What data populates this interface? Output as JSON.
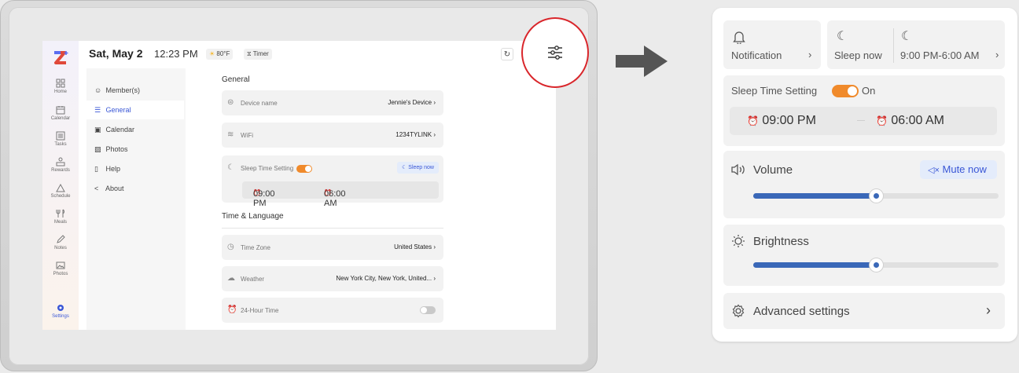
{
  "device_screen": {
    "topbar": {
      "date": "Sat, May 2",
      "time": "12:23 PM",
      "weather": "80°F",
      "timer": "Timer"
    },
    "nav": {
      "items": [
        {
          "label": "Home",
          "icon": "home-icon"
        },
        {
          "label": "Calendar",
          "icon": "calendar-icon"
        },
        {
          "label": "Tasks",
          "icon": "tasks-icon"
        },
        {
          "label": "Rewards",
          "icon": "rewards-icon"
        },
        {
          "label": "Schedule",
          "icon": "schedule-icon"
        },
        {
          "label": "Meals",
          "icon": "meals-icon"
        },
        {
          "label": "Notes",
          "icon": "notes-icon"
        },
        {
          "label": "Photos",
          "icon": "photos-icon"
        },
        {
          "label": "Settings",
          "icon": "settings-icon"
        }
      ]
    },
    "settings_menu": {
      "items": [
        {
          "label": "Member(s)"
        },
        {
          "label": "General"
        },
        {
          "label": "Calendar"
        },
        {
          "label": "Photos"
        },
        {
          "label": "Help"
        },
        {
          "label": "About"
        }
      ],
      "active": "General"
    },
    "general": {
      "heading": "General",
      "device_name_label": "Device name",
      "device_name_value": "Jennie's Device",
      "wifi_label": "WiFi",
      "wifi_value": "1234TYLINK",
      "sleep_label": "Sleep Time Setting",
      "sleep_now": "Sleep now",
      "sleep_start": "09:00 PM",
      "sleep_end": "06:00 AM"
    },
    "time_language": {
      "heading": "Time & Language",
      "timezone_label": "Time Zone",
      "timezone_value": "United States",
      "weather_label": "Weather",
      "weather_value": "New York City, New York, United...",
      "hour24_label": "24-Hour Time"
    }
  },
  "panel": {
    "notification_label": "Notification",
    "sleep_now_label": "Sleep now",
    "sleep_range": "9:00 PM-6:00 AM",
    "sleep_setting_label": "Sleep Time Setting",
    "sleep_toggle_state": "On",
    "sleep_start": "09:00 PM",
    "sleep_end": "06:00 AM",
    "volume_label": "Volume",
    "mute_label": "Mute now",
    "volume_level": 0.5,
    "brightness_label": "Brightness",
    "brightness_level": 0.5,
    "advanced_label": "Advanced settings"
  },
  "colors": {
    "accent_orange": "#f08a2b",
    "accent_blue": "#3a57d6",
    "slider_blue": "#3a68b8",
    "highlight_red": "#d9262b"
  }
}
